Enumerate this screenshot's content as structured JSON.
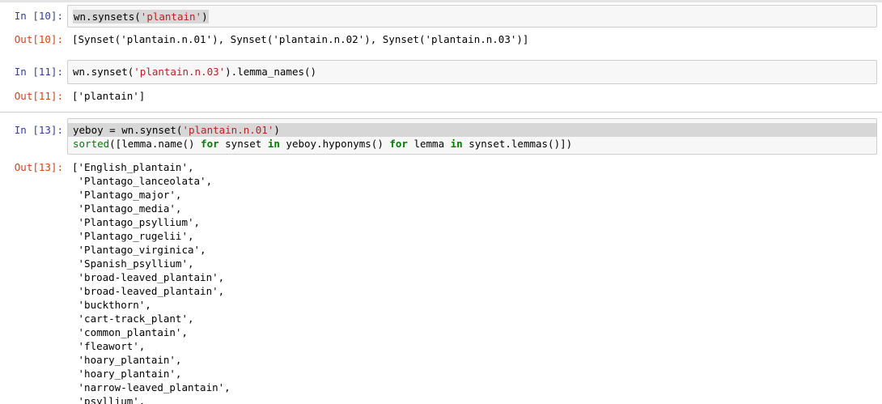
{
  "cells": [
    {
      "in_prompt": "In [10]:",
      "code": {
        "c1": "wn.synsets(",
        "c2": "'plantain'",
        "c3": ")"
      },
      "out_prompt": "Out[10]:",
      "output": "[Synset('plantain.n.01'), Synset('plantain.n.02'), Synset('plantain.n.03')]"
    },
    {
      "in_prompt": "In [11]:",
      "code": {
        "c1": "wn.synset(",
        "c2": "'plantain.n.03'",
        "c3": ").lemma_names()"
      },
      "out_prompt": "Out[11]:",
      "output": "['plantain']"
    },
    {
      "in_prompt": "In [13]:",
      "code": {
        "l1a": "yeboy = wn.synset(",
        "l1b": "'plantain.n.01'",
        "l1c": ")",
        "l2_sorted": "sorted",
        "l2a": "([lemma.name() ",
        "l2_for1": "for",
        "l2b": " synset ",
        "l2_in1": "in",
        "l2c": " yeboy.hyponyms() ",
        "l2_for2": "for",
        "l2d": " lemma ",
        "l2_in2": "in",
        "l2e": " synset.lemmas()])"
      },
      "out_prompt": "Out[13]:",
      "output_lines": [
        "['English_plantain',",
        " 'Plantago_lanceolata',",
        " 'Plantago_major',",
        " 'Plantago_media',",
        " 'Plantago_psyllium',",
        " 'Plantago_rugelii',",
        " 'Plantago_virginica',",
        " 'Spanish_psyllium',",
        " 'broad-leaved_plantain',",
        " 'broad-leaved_plantain',",
        " 'buckthorn',",
        " 'cart-track_plant',",
        " 'common_plantain',",
        " 'fleawort',",
        " 'hoary_plantain',",
        " 'hoary_plantain',",
        " 'narrow-leaved_plantain',",
        " 'psyllium',"
      ]
    }
  ],
  "colors": {
    "in_prompt": "#303f9f",
    "out_prompt": "#d84315",
    "keyword": "#008000",
    "string": "#ba2121"
  }
}
